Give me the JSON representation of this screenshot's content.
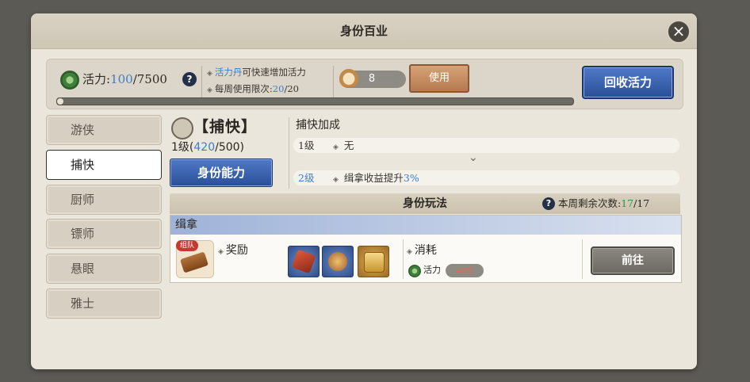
{
  "window": {
    "title": "身份百业",
    "close_icon": "×"
  },
  "stamina": {
    "label": "活力:",
    "current": "100",
    "separator": "/",
    "max": "7500",
    "help_icon": "?",
    "progress_fraction": 0.013
  },
  "tips": {
    "line1_highlight": "活力丹",
    "line1_rest": "可快速增加活力",
    "line2_prefix": "每周使用限次:",
    "line2_used": "20",
    "line2_sep": "/",
    "line2_total": "20"
  },
  "item": {
    "count": "8",
    "icon": "pill-icon"
  },
  "buttons": {
    "use": "使用",
    "recover": "回收活力",
    "ability": "身份能力",
    "go": "前往"
  },
  "sidebar": {
    "items": [
      {
        "label": "游侠",
        "active": false
      },
      {
        "label": "捕快",
        "active": true
      },
      {
        "label": "厨师",
        "active": false
      },
      {
        "label": "镖师",
        "active": false
      },
      {
        "label": "悬眼",
        "active": false
      },
      {
        "label": "雅士",
        "active": false
      }
    ]
  },
  "profession": {
    "name": "【捕快】",
    "level_prefix": "1级(",
    "exp": "420",
    "exp_sep": "/500)"
  },
  "bonus": {
    "title": "捕快加成",
    "rows": [
      {
        "level": "1级",
        "text": "无",
        "pct": ""
      },
      {
        "level": "2级",
        "text": "缉拿收益提升",
        "pct": "3%"
      }
    ],
    "chevron": "⌄"
  },
  "gameplay": {
    "title": "身份玩法",
    "remaining_label": "本周剩余次数:",
    "remaining_count": "17",
    "remaining_sep": "/",
    "remaining_total": "17",
    "card": {
      "title": "缉拿",
      "badge": "组队",
      "reward_label": "奖励",
      "cost_label": "消耗",
      "cost_resource": "活力",
      "cost_value": "400"
    }
  },
  "colors": {
    "accent_blue": "#3d7fc4",
    "accent_green": "#3f8f52",
    "button_blue": "#2a4f98",
    "cost_red": "#e06a5a"
  }
}
